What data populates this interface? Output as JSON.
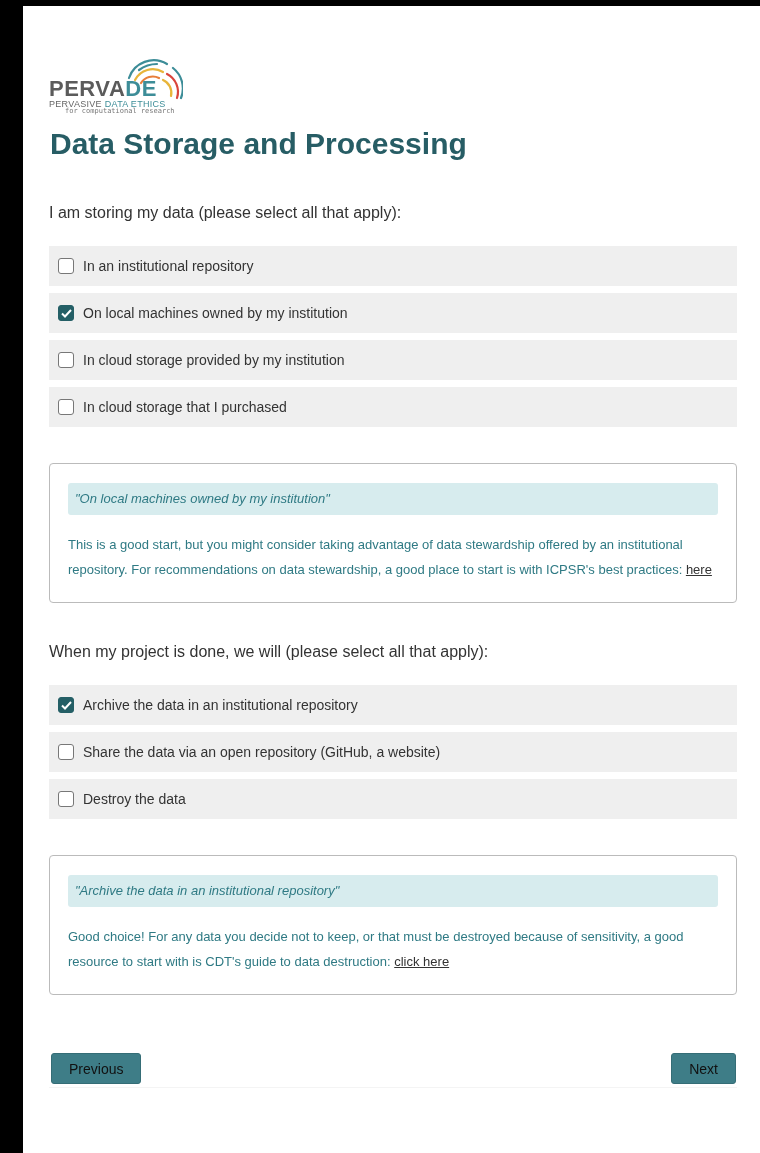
{
  "logo": {
    "name_plain": "PERVA",
    "name_accent": "DE",
    "tagline_plain": "PERVASIVE",
    "tagline_accent": "DATA ETHICS",
    "subtitle": "for computational research"
  },
  "title": "Data Storage and Processing",
  "questions": [
    {
      "prompt": "I am storing my data (please select all that apply):",
      "options": [
        {
          "label": "In an institutional repository",
          "checked": false
        },
        {
          "label": "On local machines owned by my institution",
          "checked": true
        },
        {
          "label": "In cloud storage provided by my institution",
          "checked": false
        },
        {
          "label": "In cloud storage that I purchased",
          "checked": false
        }
      ],
      "feedback": {
        "quote": "\"On local machines owned by my institution\"",
        "text": "This is a good start, but you might consider taking advantage of data stewardship offered by an institutional repository. For recommendations on data stewardship, a good place to start is with ICPSR's best practices:",
        "link": "here"
      }
    },
    {
      "prompt": "When my project is done, we will (please select all that apply):",
      "options": [
        {
          "label": "Archive the data in an institutional repository",
          "checked": true
        },
        {
          "label": "Share the data via an open repository (GitHub, a website)",
          "checked": false
        },
        {
          "label": "Destroy the data",
          "checked": false
        }
      ],
      "feedback": {
        "quote": "\"Archive the data in an institutional repository\"",
        "text": "Good choice! For any data you decide not to keep, or that must be destroyed because of sensitivity, a good resource to start with is CDT's guide to data destruction:",
        "link": "click here"
      }
    }
  ],
  "buttons": {
    "previous": "Previous",
    "next": "Next"
  }
}
